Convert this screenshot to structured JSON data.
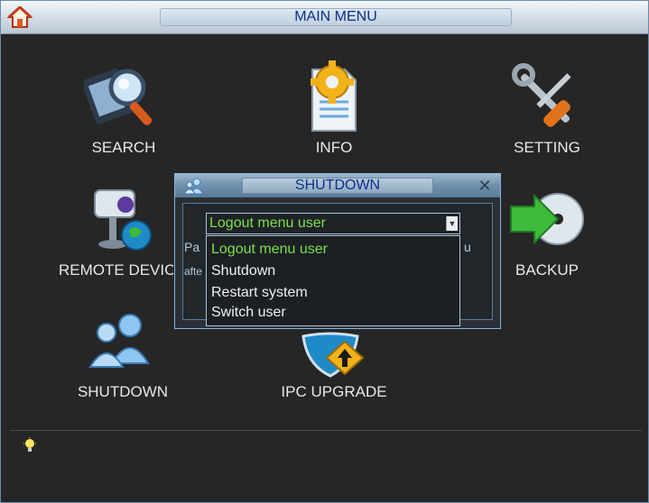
{
  "window": {
    "title": "MAIN MENU"
  },
  "menu": {
    "search": "SEARCH",
    "info": "INFO",
    "setting": "SETTING",
    "remote_device": "REMOTE DEVIC",
    "backup": "BACKUP",
    "shutdown": "SHUTDOWN",
    "ipc_upgrade": "IPC UPGRADE"
  },
  "dialog": {
    "title": "SHUTDOWN",
    "close_glyph": "✕",
    "selected": "Logout menu user",
    "hint_left_1": "Pa",
    "hint_left_2": "afte",
    "hint_right": "u",
    "options": [
      "Logout menu user",
      "Shutdown",
      "Restart system",
      "Switch user"
    ],
    "highlight_color": "#7be04a"
  }
}
